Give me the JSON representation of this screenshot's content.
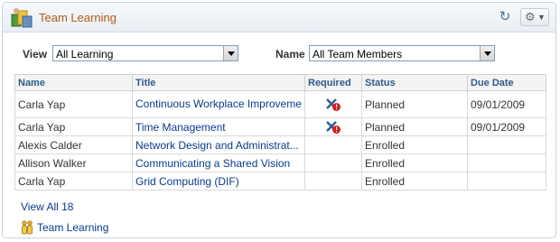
{
  "pagelet": {
    "title": "Team Learning",
    "icons": {
      "app": "team-learning-icon",
      "refresh": "refresh-icon",
      "settings": "gear-icon"
    }
  },
  "filters": {
    "view_label": "View",
    "view_value": "All Learning",
    "name_label": "Name",
    "name_value": "All Team Members"
  },
  "table": {
    "headers": [
      "Name",
      "Title",
      "Required",
      "Status",
      "Due Date"
    ],
    "rows": [
      {
        "name": "Carla Yap",
        "title": "Continuous Workplace Improveme",
        "required": true,
        "status": "Planned",
        "due": "09/01/2009"
      },
      {
        "name": "Carla Yap",
        "title": "Time Management",
        "required": true,
        "status": "Planned",
        "due": "09/01/2009"
      },
      {
        "name": "Alexis Calder",
        "title": "Network Design and Administrat...",
        "required": false,
        "status": "Enrolled",
        "due": ""
      },
      {
        "name": "Allison Walker",
        "title": "Communicating a Shared Vision",
        "required": false,
        "status": "Enrolled",
        "due": ""
      },
      {
        "name": "Carla Yap",
        "title": "Grid Computing (DIF)",
        "required": false,
        "status": "Enrolled",
        "due": ""
      }
    ]
  },
  "view_all": "View All 18",
  "footer_link": "Team Learning"
}
